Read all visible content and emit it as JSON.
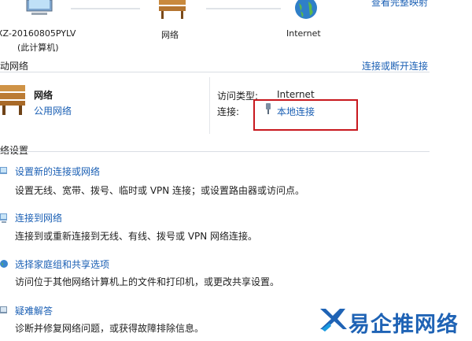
{
  "map": {
    "view_full_map": "查看完整映射",
    "computer_name": "XZ-20160805PYLV",
    "computer_sub": "(此计算机)",
    "network_label": "网络",
    "internet_label": "Internet"
  },
  "active": {
    "title": "动网络",
    "connect_disconnect": "连接或断开连接",
    "network_name": "网络",
    "network_type": "公用网络",
    "access_type_label": "访问类型:",
    "access_type_value": "Internet",
    "connection_label": "连接:",
    "connection_value": "本地连接"
  },
  "settings": {
    "title": "络设置",
    "tasks": [
      {
        "link": "设置新的连接或网络",
        "desc": "设置无线、宽带、拨号、临时或 VPN 连接；或设置路由器或访问点。",
        "icon": "new-connection-icon"
      },
      {
        "link": "连接到网络",
        "desc": "连接到或重新连接到无线、有线、拨号或 VPN 网络连接。",
        "icon": "connect-network-icon"
      },
      {
        "link": "选择家庭组和共享选项",
        "desc": "访问位于其他网络计算机上的文件和打印机，或更改共享设置。",
        "icon": "homegroup-icon"
      },
      {
        "link": "疑难解答",
        "desc": "诊断并修复网络问题，或获得故障排除信息。",
        "icon": "troubleshoot-icon"
      }
    ]
  },
  "watermark": {
    "text": "易企推网络"
  },
  "colors": {
    "link": "#1a5fb4",
    "highlight": "#c8181e"
  }
}
